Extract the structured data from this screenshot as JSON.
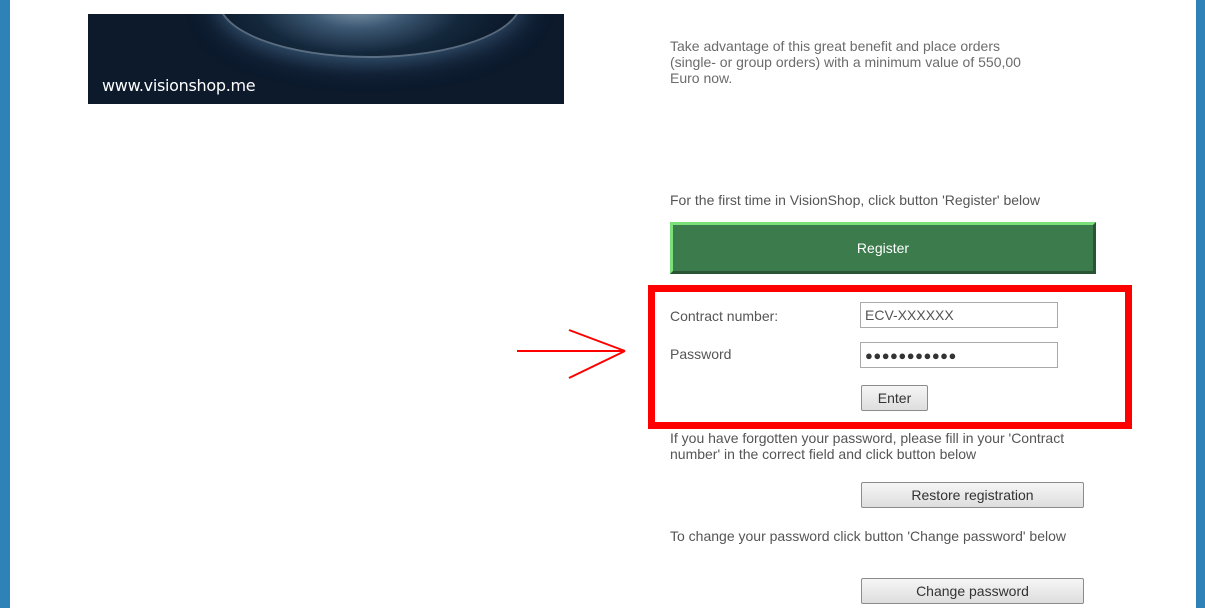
{
  "banner": {
    "url_text": "www.visionshop.me"
  },
  "texts": {
    "benefit": "Take advantage of this great benefit and place orders (single- or group orders) with a minimum value of 550,00 Euro now.",
    "first_time": "For the first time in VisionShop, click button 'Register' below",
    "forgot": "If you have forgotten your password, please fill in your 'Contract number' in the correct field and click button below",
    "change_password": "To change your password click button 'Change password' below"
  },
  "register": {
    "label": "Register"
  },
  "login": {
    "contract_label": "Contract number:",
    "contract_value": "ECV-XXXXXX",
    "password_label": "Password",
    "password_value": "●●●●●●●●●●●",
    "enter_label": "Enter"
  },
  "buttons": {
    "restore": "Restore registration",
    "change": "Change password"
  },
  "colors": {
    "frame": "#2f82b7",
    "register_bg": "#3b7b4c",
    "highlight": "#ff0000"
  }
}
